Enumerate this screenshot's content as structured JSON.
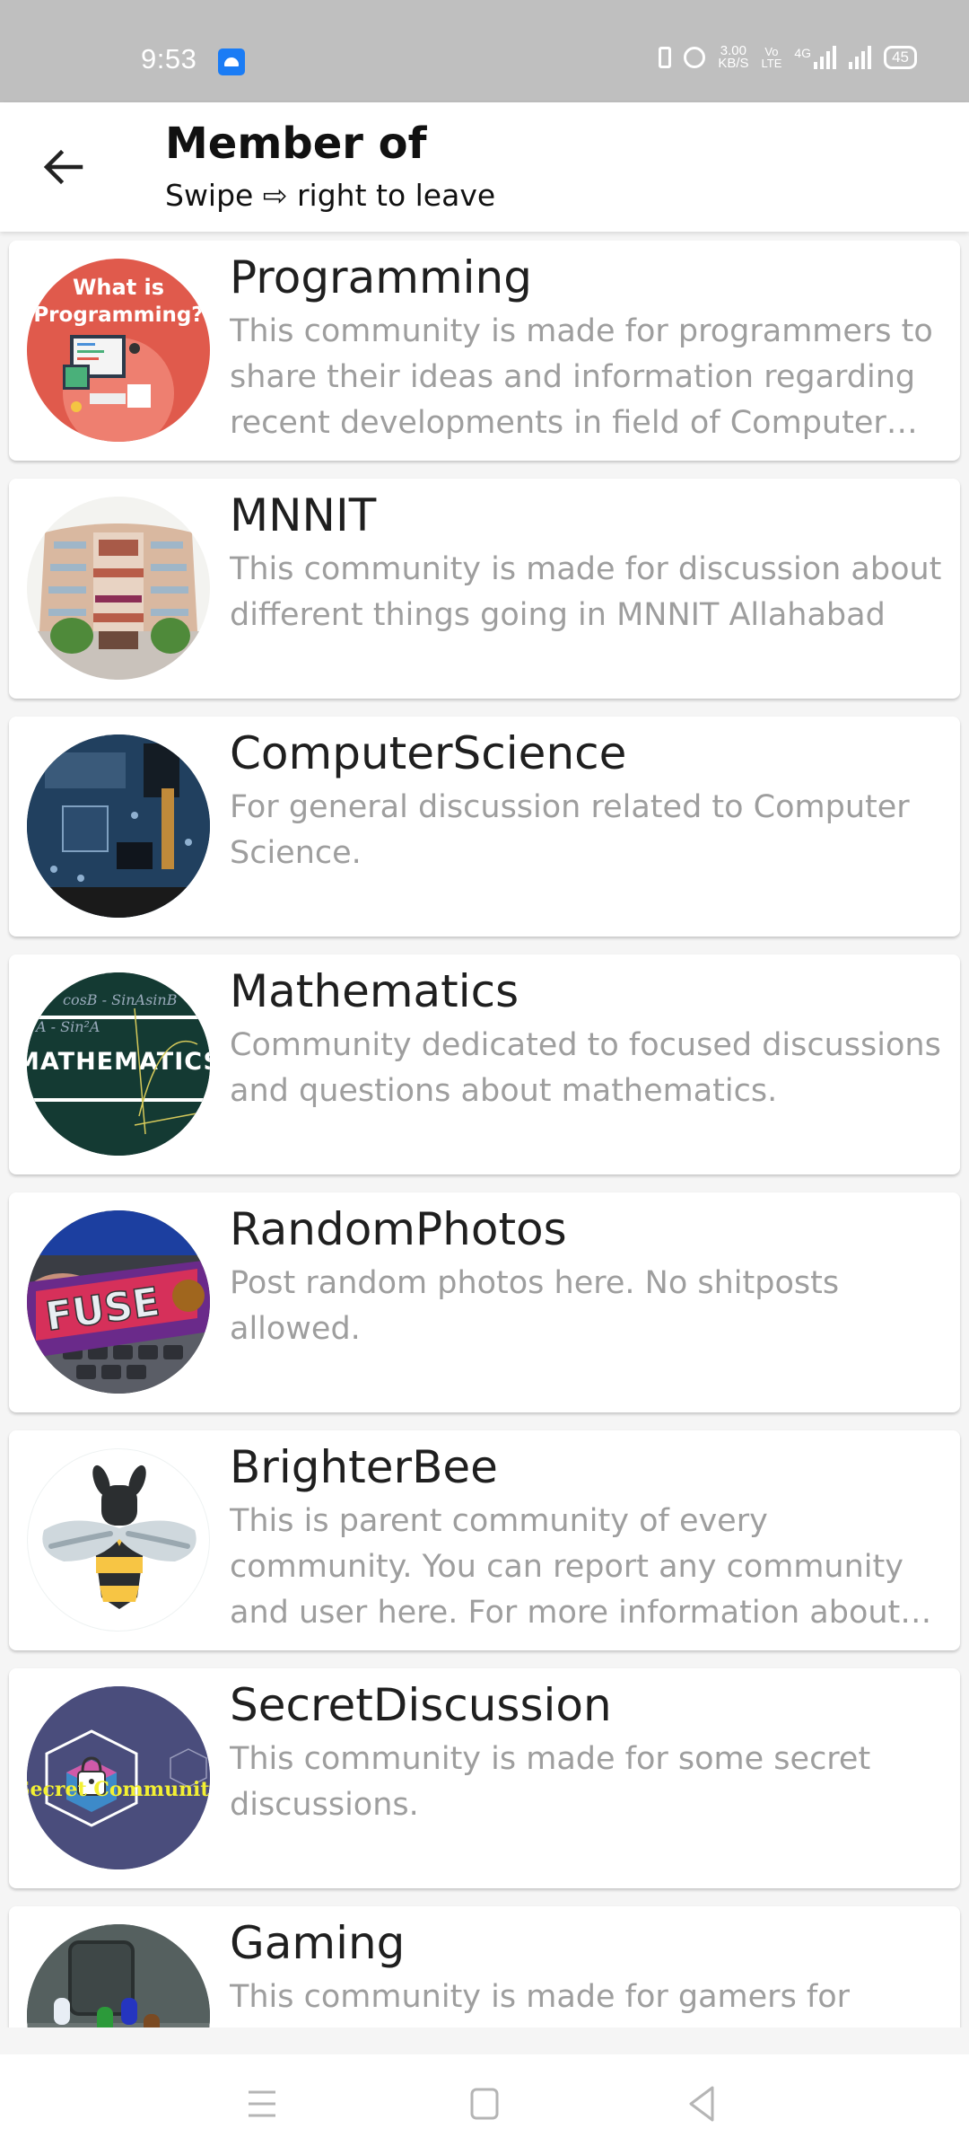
{
  "status_bar": {
    "time": "9:53",
    "notification_icon": "android-icon",
    "net_speed_value": "3.00",
    "net_speed_unit": "KB/S",
    "volte_top": "Vo",
    "volte_bottom": "LTE",
    "network_type": "4G",
    "battery_level": "45",
    "icons": [
      "vibrate-icon",
      "alarm-icon",
      "volte-icon",
      "signal-4g-icon",
      "signal-icon",
      "battery-icon"
    ]
  },
  "app_bar": {
    "back_icon": "arrow-left-icon",
    "title": "Member of",
    "subtitle": "Swipe ⇨ right to leave"
  },
  "communities": [
    {
      "name": "Programming",
      "description": "This community is made for programmers to share their ideas and information regarding recent developments in field of Computer Science and technology.",
      "avatar": "programming-avatar",
      "avatar_text": "What is Programming?",
      "avatar_color": "#e05a4c"
    },
    {
      "name": "MNNIT",
      "description": "This community is made for discussion about different things going in MNNIT Allahabad",
      "avatar": "mnnit-building-avatar",
      "avatar_color": "#d8b39c"
    },
    {
      "name": "ComputerScience",
      "description": "For general discussion related to Computer Science.",
      "avatar": "circuit-board-avatar",
      "avatar_color": "#1c3550"
    },
    {
      "name": "Mathematics",
      "description": "Community dedicated to focused discussions and questions about mathematics.",
      "avatar": "mathematics-chalkboard-avatar",
      "avatar_text": "MATHEMATICS",
      "avatar_color": "#12352f"
    },
    {
      "name": "RandomPhotos",
      "description": "Post random photos here. No shitposts allowed.",
      "avatar": "fuse-chocolate-avatar",
      "avatar_text": "FUSE",
      "avatar_color": "#7a2a80"
    },
    {
      "name": "BrighterBee",
      "description": "This is parent community of every community. You can report any community and user here. For more information about this app visit the about page.",
      "avatar": "bee-avatar",
      "avatar_color": "#ffffff"
    },
    {
      "name": "SecretDiscussion",
      "description": "This community is made for some secret discussions.",
      "avatar": "secret-community-avatar",
      "avatar_text": "Secret Community",
      "avatar_color": "#4a4d7c"
    },
    {
      "name": "Gaming",
      "description": "This community is made for gamers for",
      "avatar": "among-us-avatar",
      "avatar_color": "#4b5456"
    }
  ],
  "nav_bar": {
    "recents": "menu-icon",
    "home": "home-square-icon",
    "back": "back-triangle-icon"
  }
}
